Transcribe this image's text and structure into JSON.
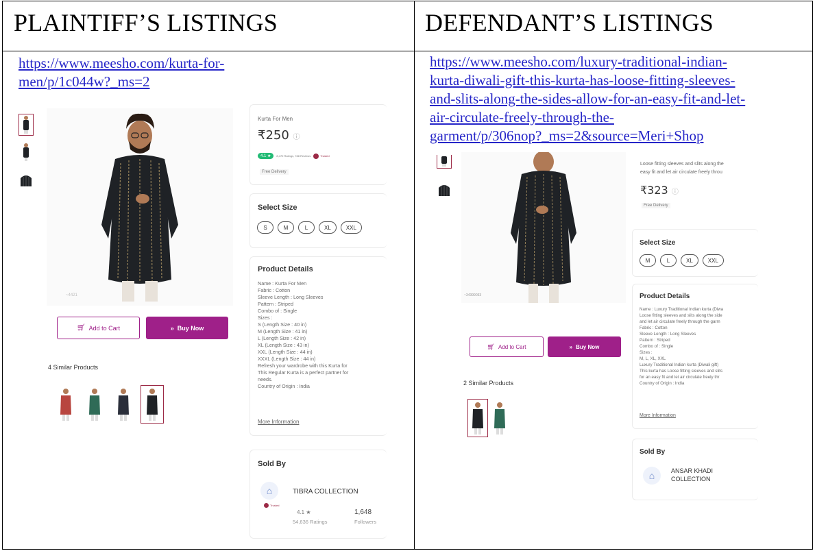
{
  "headers": {
    "plaintiff": "PLAINTIFF’S LISTINGS",
    "defendant": "DEFENDANT’S LISTINGS"
  },
  "plaintiff": {
    "url_lines": [
      "https://www.meesho.com/kurta-for-",
      "men/p/1c044w?_ms=2"
    ],
    "product_name": "Kurta For Men",
    "price": "₹250",
    "price_info": "ⓘ",
    "rating": "4.1 ★",
    "ratings_reviews": "8,470 Ratings, 788 Reviews",
    "trusted_badge": "Trusted",
    "delivery": "Free Delivery",
    "image_caption": "~4421",
    "select_size_title": "Select Size",
    "sizes": [
      "S",
      "M",
      "L",
      "XL",
      "XXL"
    ],
    "details_title": "Product Details",
    "details_lines": [
      "Name : Kurta For Men",
      "Fabric : Cotton",
      "Sleeve Length : Long Sleeves",
      "Pattern : Striped",
      "Combo of : Single",
      "Sizes :",
      "S (Length Size : 40 in)",
      "M (Length Size : 41 in)",
      "L (Length Size : 42 in)",
      "XL (Length Size : 43 in)",
      "XXL (Length Size : 44 in)",
      "XXXL (Length Size : 44 in)",
      "Refresh your wardrobe with this Kurta for",
      "This Regular Kurta is a perfect partner for",
      "needs.",
      "Country of Origin : India"
    ],
    "more_info": "More Information",
    "add_to_cart": "Add to Cart",
    "buy_now": "Buy Now",
    "similar_title": "4 Similar Products",
    "sold_by_title": "Sold By",
    "seller_name": "TIBRA COLLECTION",
    "seller_badge": "Trusted",
    "seller_rating": "4.1 ★",
    "seller_ratings_count": "54,636 Ratings",
    "seller_followers": "1,648",
    "seller_followers_label": "Followers"
  },
  "defendant": {
    "url_lines": [
      "https://www.meesho.com/luxury-traditional-indian-",
      "kurta-diwali-gift-this-kurta-has-loose-fitting-sleeves-",
      "and-slits-along-the-sides-allow-for-an-easy-fit-and-let-",
      "air-circulate-freely-through-the-",
      "garment/p/306nop?_ms=2&source=Meri+Shop"
    ],
    "desc_lines": [
      "Loose fitting sleeves and slits along the",
      "easy fit and let air circulate freely throu"
    ],
    "price": "₹323",
    "price_info": "ⓘ",
    "delivery": "Free Delivery",
    "image_caption": "~34399033",
    "select_size_title": "Select Size",
    "sizes": [
      "M",
      "L",
      "XL",
      "XXL"
    ],
    "details_title": "Product Details",
    "details_lines": [
      "Name : Luxury Traditional Indian kurta (Diwa",
      "Loose fitting sleeves and slits along the side",
      "and let air circulate freely through the garm",
      "Fabric : Cotton",
      "Sleeve Length : Long Sleeves",
      "Pattern : Striped",
      "Combo of : Single",
      "Sizes :",
      "M, L, XL, XXL",
      "Luxury Traditional Indian kurta (Diwali gift)",
      "This kurta has Loose fitting sleeves and slits",
      "for an easy fit and let air circulate freely thr",
      "Country of Origin : India"
    ],
    "more_info": "More Information",
    "add_to_cart": "Add to Cart",
    "buy_now": "Buy Now",
    "similar_title": "2 Similar Products",
    "sold_by_title": "Sold By",
    "seller_name_lines": [
      "ANSAR KHADI",
      "COLLECTION"
    ]
  },
  "icons": {
    "cart": "cart-icon",
    "buy": "double-chevron-icon",
    "shop": "shop-icon",
    "info": "info-icon"
  },
  "colors": {
    "link": "#2525c8",
    "brand": "#9f2089",
    "rating_green": "#23bb75",
    "kurta_black": "#1f2226",
    "kurta_green": "#2f6b57",
    "kurta_red": "#b8453f"
  }
}
